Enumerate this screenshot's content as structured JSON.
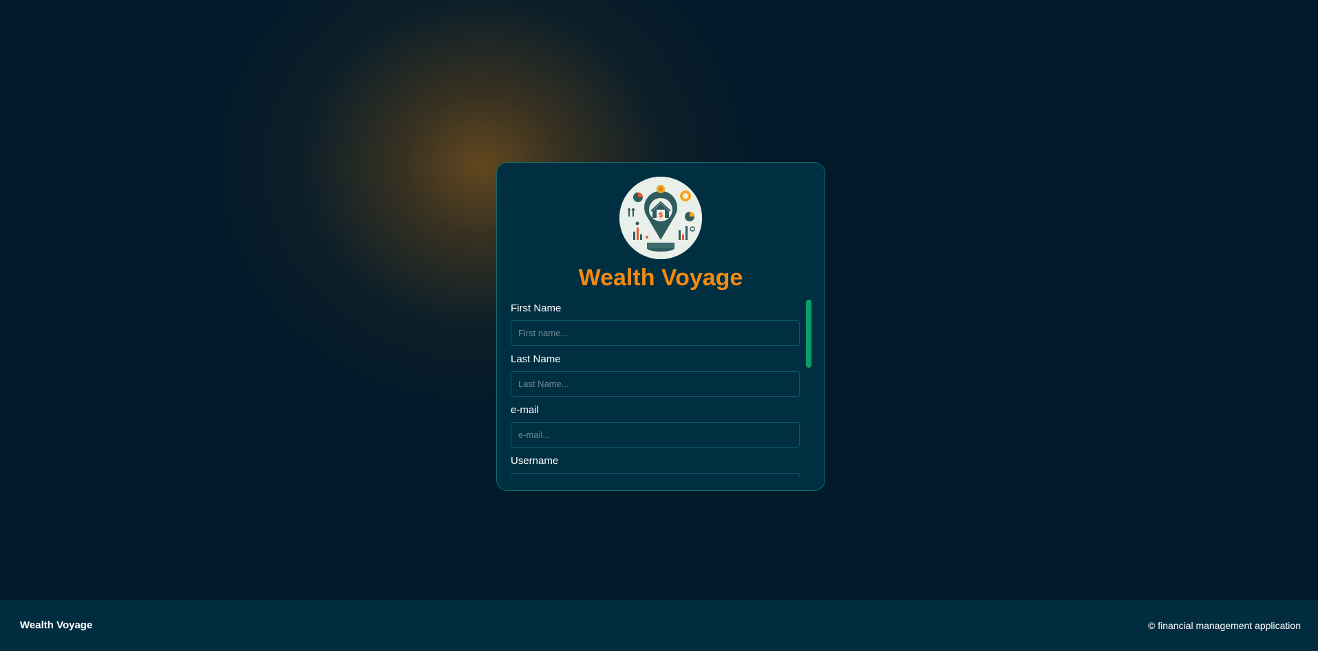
{
  "app": {
    "title": "Wealth Voyage"
  },
  "card": {
    "logo_icon": "financial-house-pin-logo",
    "title": "Wealth Voyage"
  },
  "form": {
    "fields": [
      {
        "label": "First Name",
        "placeholder": "First name...",
        "value": ""
      },
      {
        "label": "Last Name",
        "placeholder": "Last Name...",
        "value": ""
      },
      {
        "label": "e-mail",
        "placeholder": "e-mail...",
        "value": ""
      },
      {
        "label": "Username",
        "placeholder": "",
        "value": ""
      }
    ]
  },
  "footer": {
    "brand": "Wealth Voyage",
    "copyright": "© financial management application"
  },
  "colors": {
    "accent": "#f38a11",
    "scrollbar": "#0aa06c",
    "card_bg": "#012f42",
    "page_bg": "#02192a",
    "footer_bg": "#022d41"
  }
}
